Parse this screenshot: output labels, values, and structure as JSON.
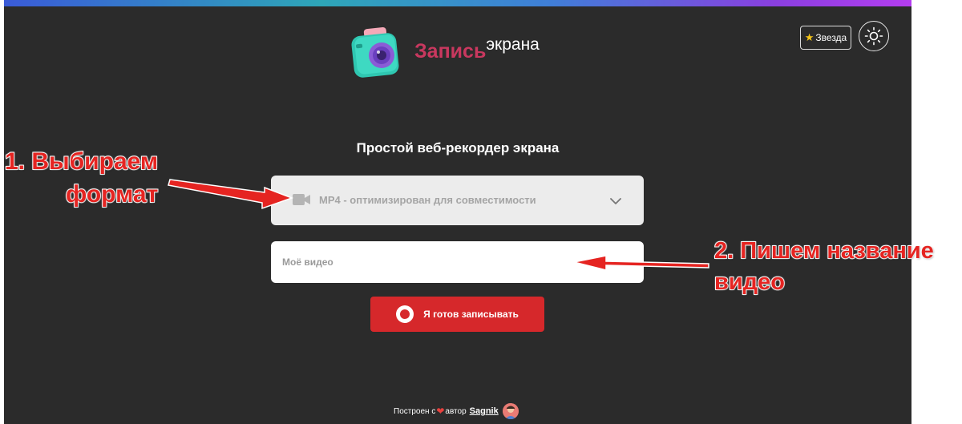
{
  "header": {
    "brand_word1": "Запись",
    "brand_word2": "экрана",
    "star_label": "Звезда",
    "logo_icon": "camera-icon",
    "theme_icon": "sun-icon"
  },
  "main": {
    "subtitle": "Простой веб-рекордер экрана",
    "format_select": {
      "value": "MP4 - оптимизирован для совместимости"
    },
    "title_input": {
      "placeholder": "Моё видео",
      "value": ""
    },
    "record_button": {
      "label": "Я готов записывать"
    }
  },
  "footer": {
    "built_with": "Построен с",
    "author_prefix": "автор",
    "author_name": "Sagnik"
  },
  "annotations": {
    "step1_line1": "1. Выбираем",
    "step1_line2": "формат",
    "step2_line1": "2. Пишем название",
    "step2_line2": "видео"
  },
  "colors": {
    "background": "#2b2b2b",
    "brand_accent": "#c9385f",
    "record_button": "#d6282b",
    "annotation": "#e52421",
    "star": "#f5c518"
  }
}
